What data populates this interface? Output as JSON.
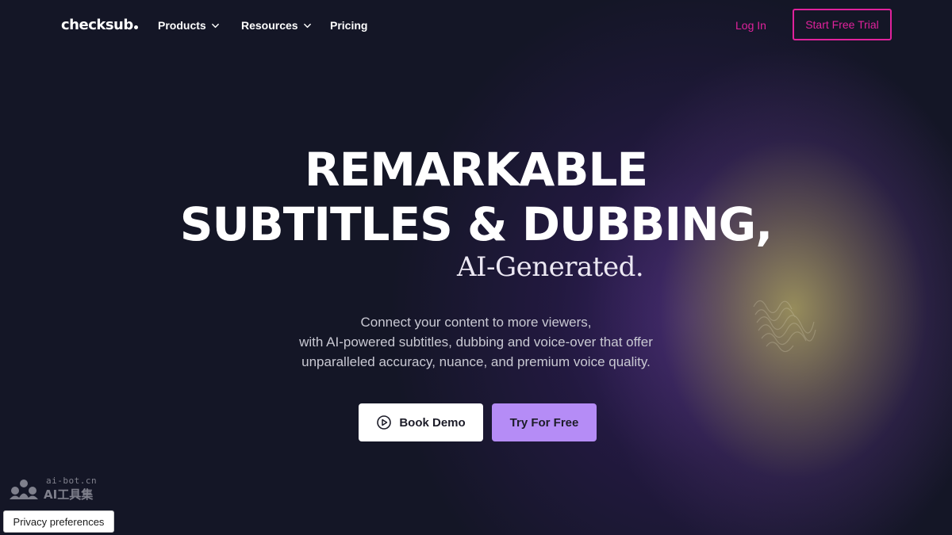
{
  "nav": {
    "logo": "checksub",
    "products": "Products",
    "resources": "Resources",
    "pricing": "Pricing",
    "login": "Log In",
    "trial": "Start Free Trial"
  },
  "hero": {
    "line1": "REMARKABLE",
    "line2": "SUBTITLES & DUBBING,",
    "tagline": "AI-Generated.",
    "desc1": "Connect your content to more viewers,",
    "desc2": "with AI-powered subtitles, dubbing and voice-over that offer",
    "desc3": "unparalleled accuracy, nuance, and premium voice quality."
  },
  "cta": {
    "demo": "Book Demo",
    "free": "Try For Free"
  },
  "watermark": {
    "url": "ai-bot.cn",
    "name": "AI工具集"
  },
  "privacy": "Privacy preferences",
  "colors": {
    "background": "#141626",
    "accent_magenta": "#e0229c",
    "accent_lavender": "#b58cf6"
  },
  "icons": {
    "nav_chevron": "chevron-down-icon",
    "demo_play": "play-circle-icon"
  }
}
